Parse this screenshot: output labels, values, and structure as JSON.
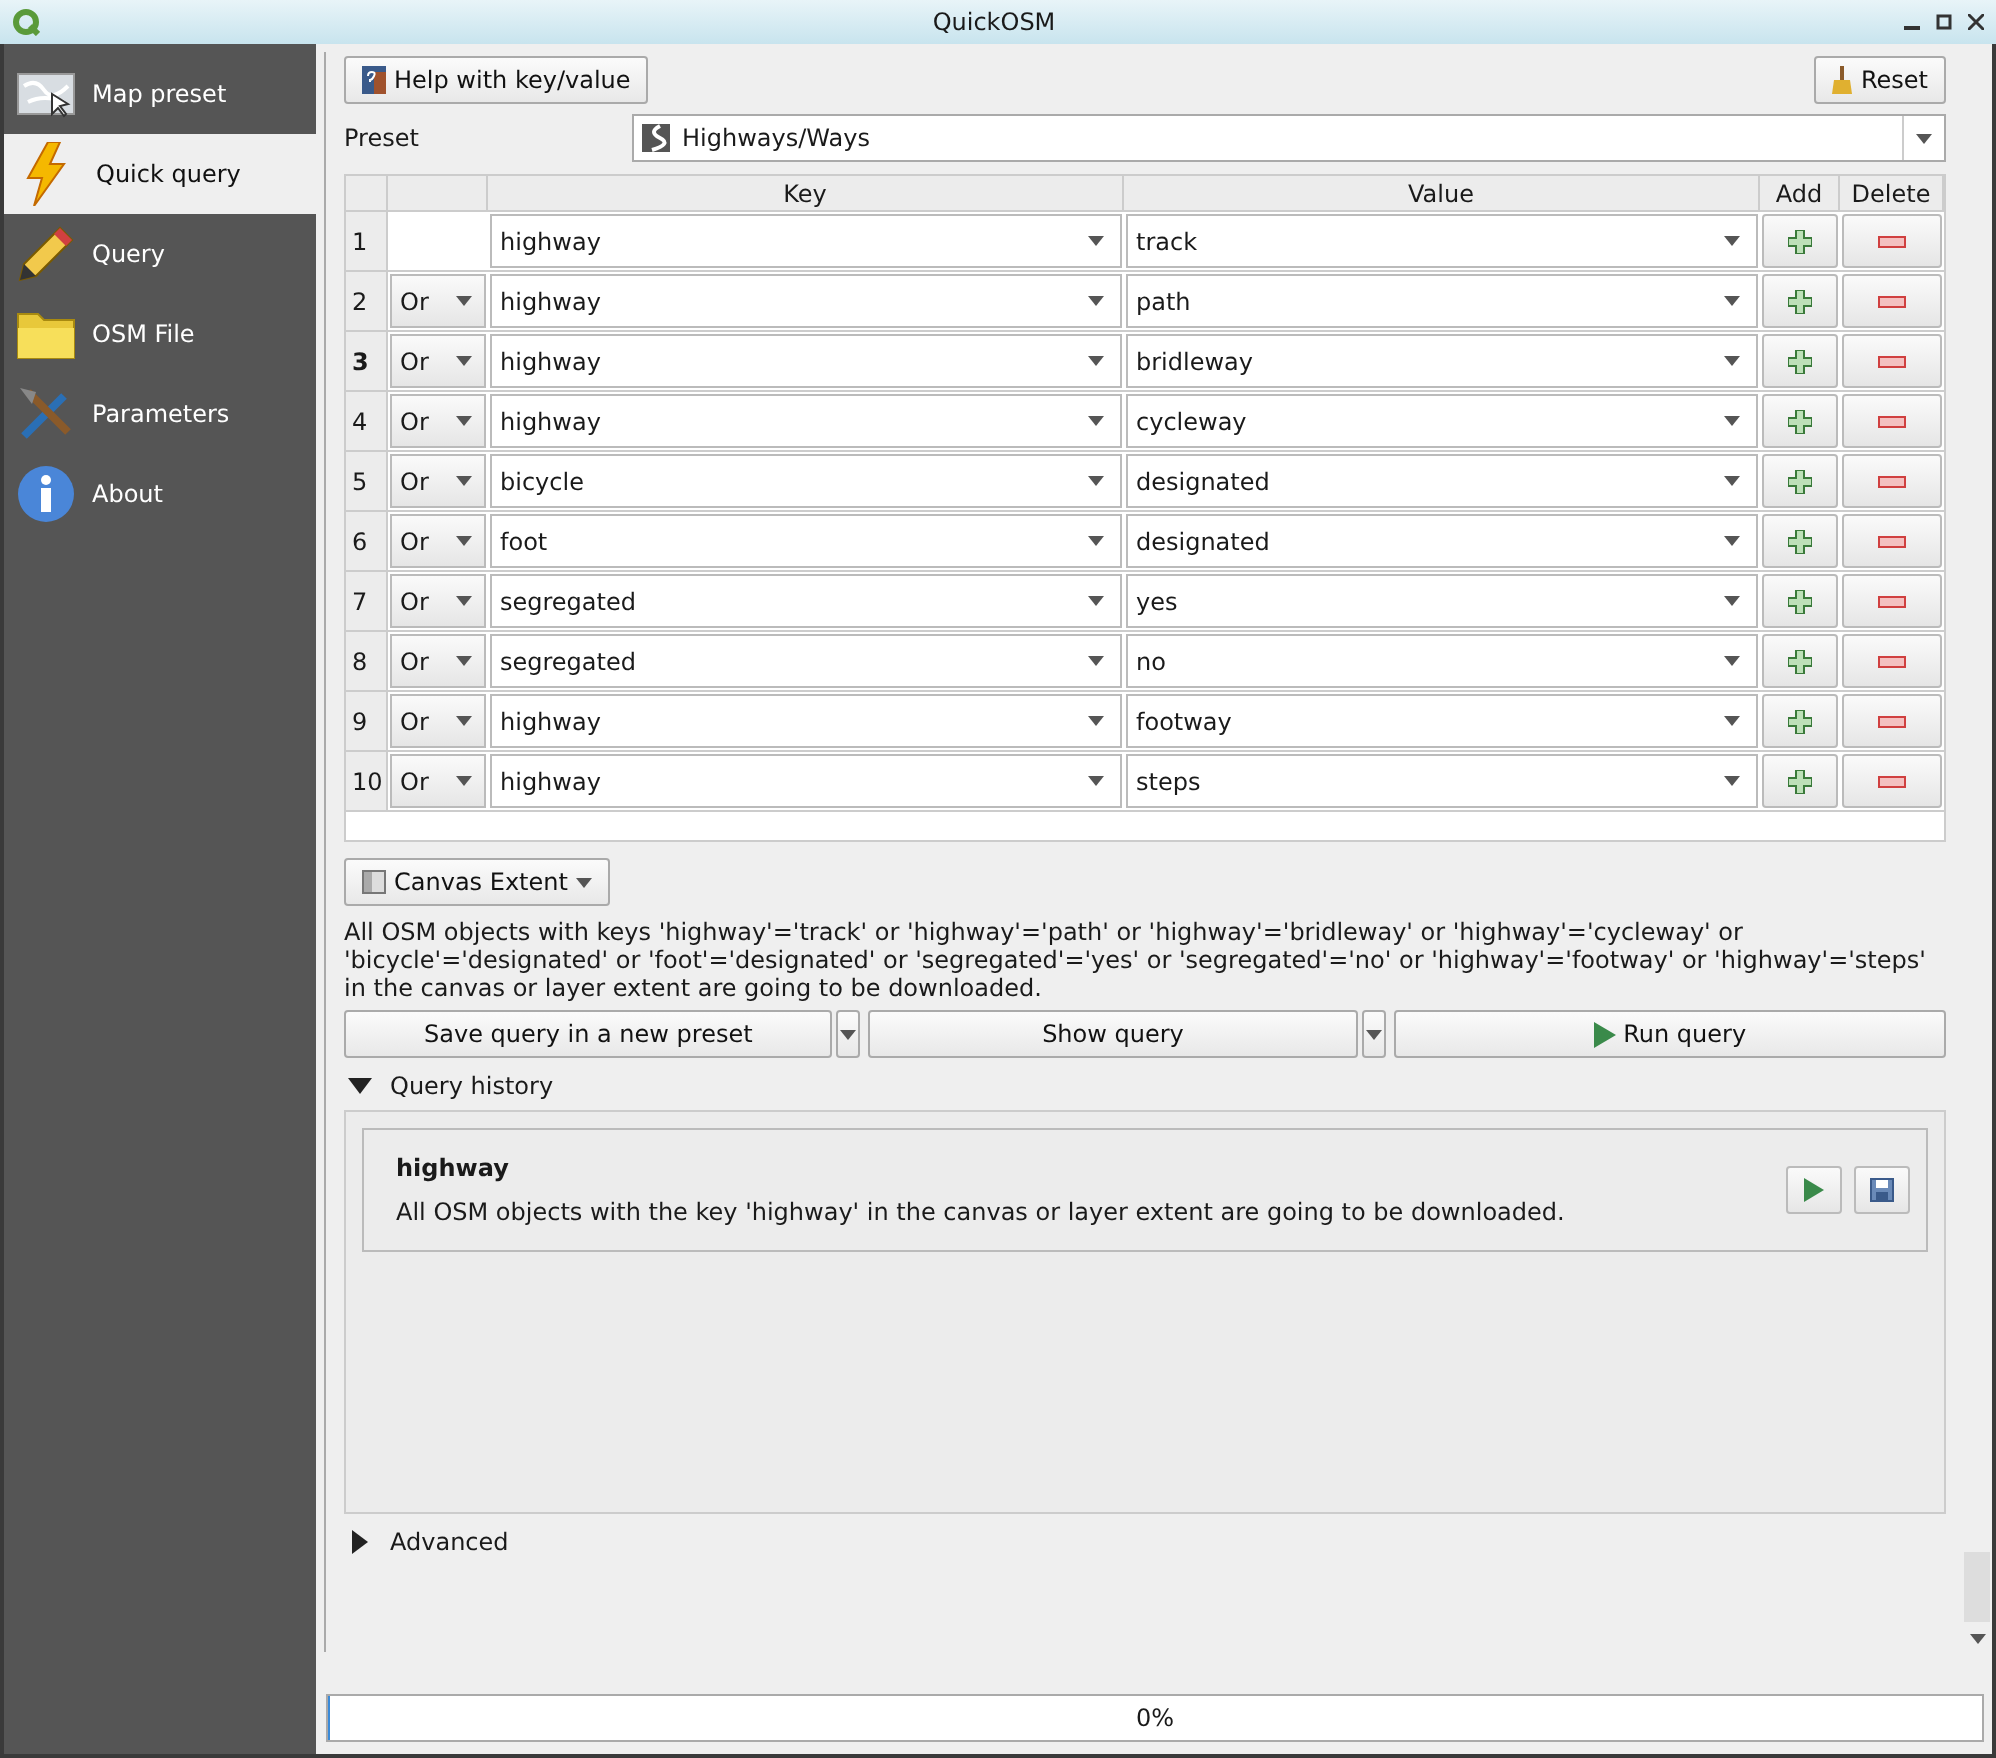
{
  "window": {
    "title": "QuickOSM"
  },
  "sidebar": {
    "items": [
      {
        "label": "Map preset",
        "selected": false
      },
      {
        "label": "Quick query",
        "selected": true
      },
      {
        "label": "Query",
        "selected": false
      },
      {
        "label": "OSM File",
        "selected": false
      },
      {
        "label": "Parameters",
        "selected": false
      },
      {
        "label": "About",
        "selected": false
      }
    ]
  },
  "help_button": "Help with key/value",
  "reset_button": "Reset",
  "preset": {
    "label": "Preset",
    "value": "Highways/Ways"
  },
  "table": {
    "columns": [
      "Key",
      "Value",
      "Add",
      "Delete"
    ],
    "rows": [
      {
        "number": "1",
        "current": false,
        "operator": null,
        "key": "highway",
        "value": "track"
      },
      {
        "number": "2",
        "current": false,
        "operator": "Or",
        "key": "highway",
        "value": "path"
      },
      {
        "number": "3",
        "current": true,
        "operator": "Or",
        "key": "highway",
        "value": "bridleway"
      },
      {
        "number": "4",
        "current": false,
        "operator": "Or",
        "key": "highway",
        "value": "cycleway"
      },
      {
        "number": "5",
        "current": false,
        "operator": "Or",
        "key": "bicycle",
        "value": "designated"
      },
      {
        "number": "6",
        "current": false,
        "operator": "Or",
        "key": "foot",
        "value": "designated"
      },
      {
        "number": "7",
        "current": false,
        "operator": "Or",
        "key": "segregated",
        "value": "yes"
      },
      {
        "number": "8",
        "current": false,
        "operator": "Or",
        "key": "segregated",
        "value": "no"
      },
      {
        "number": "9",
        "current": false,
        "operator": "Or",
        "key": "highway",
        "value": "footway"
      },
      {
        "number": "10",
        "current": false,
        "operator": "Or",
        "key": "highway",
        "value": "steps"
      }
    ]
  },
  "extent": "Canvas Extent",
  "description": "All OSM objects with keys 'highway'='track' or 'highway'='path' or 'highway'='bridleway' or 'highway'='cycleway' or 'bicycle'='designated' or 'foot'='designated' or 'segregated'='yes' or 'segregated'='no' or 'highway'='footway' or 'highway'='steps' in the canvas or layer extent are going to be downloaded.",
  "buttons": {
    "save": "Save query in a new preset",
    "show": "Show query",
    "run": "Run query"
  },
  "query_history": {
    "label": "Query history",
    "expanded": true,
    "items": [
      {
        "title": "highway",
        "description": "All OSM objects with the key 'highway' in the canvas or layer extent are going to be downloaded."
      }
    ]
  },
  "advanced": {
    "label": "Advanced",
    "expanded": false
  },
  "progress": {
    "text": "0%",
    "level": 0
  }
}
